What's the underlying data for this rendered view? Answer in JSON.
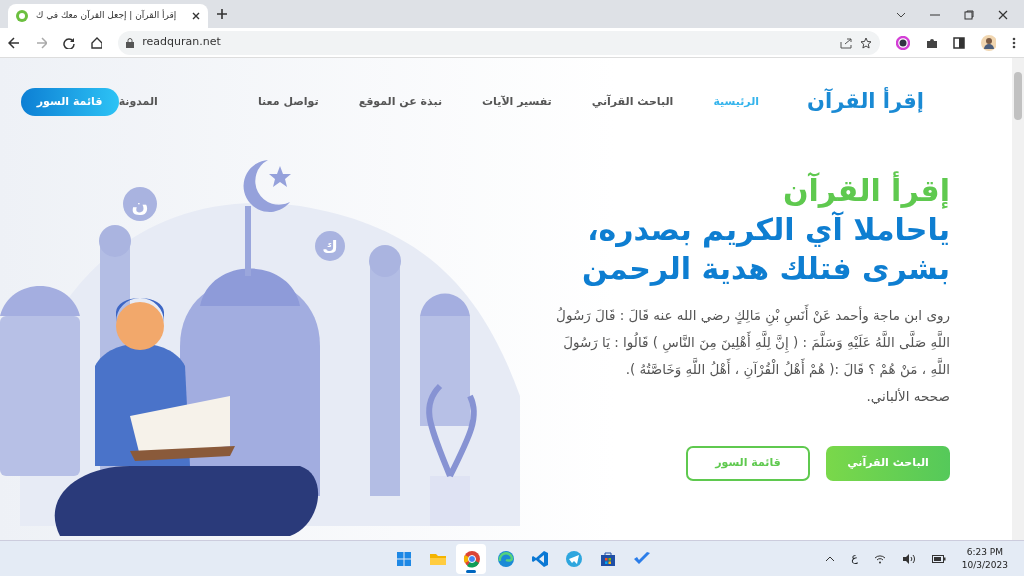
{
  "browser": {
    "tab_title": "إقرأ القرآن | إجعل القرآن معك في ك",
    "url": "readquran.net"
  },
  "nav": {
    "logo": "إقرأ القرآن",
    "items": [
      {
        "label": "الرئيسية",
        "selected": true
      },
      {
        "label": "الباحث القرآني",
        "selected": false
      },
      {
        "label": "تفسير الآيات",
        "selected": false
      },
      {
        "label": "نبذة عن الموقع",
        "selected": false
      },
      {
        "label": "تواصل معنا",
        "selected": false
      },
      {
        "label": "المدونة",
        "selected": false
      }
    ],
    "cta": "قائمة السور"
  },
  "hero": {
    "title": "إقرأ القرآن",
    "subtitle_lines": [
      "ياحاملا آي الكريم بصدره،",
      "بشرى فتلك هدية الرحمن"
    ],
    "paragraph": "روى ابن ماجة وأحمد عَنْ أَنَسِ بْنِ مَالِكٍ رضي الله عنه قَالَ : قَالَ رَسُولُ اللَّهِ صَلَّى اللَّهُ عَلَيْهِ وَسَلَّمَ : ( إِنَّ لِلَّهِ أَهْلِينَ مِنَ النَّاسِ ) قَالُوا : يَا رَسُولَ اللَّهِ ، مَنْ هُمْ ؟ قَالَ :( هُمْ أَهْلُ الْقُرْآنِ ، أَهْلُ اللَّهِ وَخَاصَّتُهُ ).",
    "source": "صححه الألباني.",
    "buttons": [
      {
        "label": "الباحث القرآني",
        "kind": "primary"
      },
      {
        "label": "قائمة السور",
        "kind": "outline"
      }
    ],
    "illustration_letters": [
      "ن",
      "ك"
    ]
  },
  "taskbar": {
    "apps": [
      {
        "kind": "start",
        "selected": false
      },
      {
        "kind": "folder",
        "selected": false
      },
      {
        "kind": "chrome",
        "selected": true
      },
      {
        "kind": "edge",
        "selected": false
      },
      {
        "kind": "code",
        "selected": false
      },
      {
        "kind": "telegram",
        "selected": false
      },
      {
        "kind": "store",
        "selected": false
      },
      {
        "kind": "todo",
        "selected": false
      }
    ],
    "language": "ع",
    "time": "6:23 PM",
    "date": "10/3/2023"
  }
}
